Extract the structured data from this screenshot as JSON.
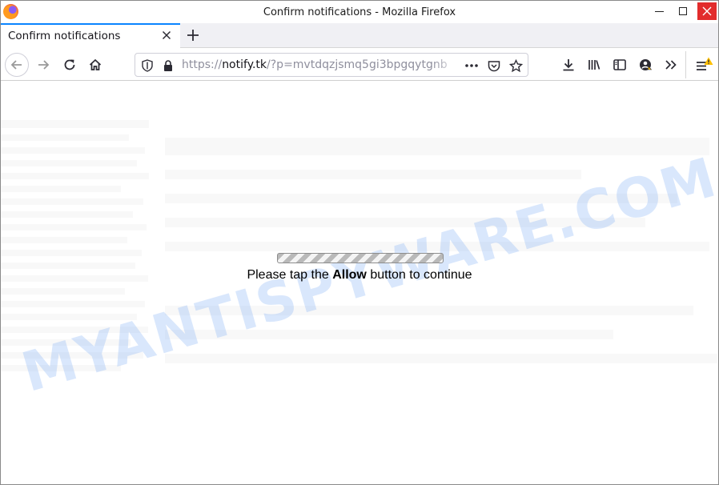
{
  "window": {
    "title": "Confirm notifications - Mozilla Firefox",
    "controls": {
      "minimize": "minimize",
      "maximize": "maximize",
      "close": "close"
    },
    "colors": {
      "close": "#e22c2c",
      "tab_accent": "#0a84ff"
    }
  },
  "tabs": [
    {
      "label": "Confirm notifications",
      "active": true
    }
  ],
  "nav": {
    "icons": [
      "back-arrow-icon",
      "forward-arrow-icon",
      "reload-icon",
      "home-icon"
    ]
  },
  "url": {
    "scheme": "https://",
    "host": "notify.tk",
    "path": "/?p=mvtdqzjsmq5gi3bpgqytgnb",
    "page_actions_icon": "ellipsis-icon"
  },
  "toolbar": {
    "icons": [
      "download-icon",
      "library-icon",
      "sidebar-icon",
      "account-icon",
      "overflow-chevrons-icon",
      "hamburger-menu-icon"
    ],
    "menu_warning": "warning-badge-icon"
  },
  "content": {
    "watermark": "MYANTISPYWARE.COM",
    "progress": {
      "value": 1.0,
      "style": "striped"
    },
    "message": {
      "before": "Please tap the ",
      "emphasis": "Allow",
      "after": " button to continue"
    }
  }
}
